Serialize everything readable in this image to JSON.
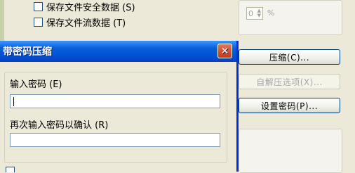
{
  "options": {
    "save_security_label": "保存文件安全数据 (S)",
    "save_streams_label": "保存文件流数据 (T)"
  },
  "right_panel": {
    "spinner_value": "0",
    "percent_sign": "%",
    "compress_button": "压缩(C)...",
    "extract_options_button": "自解压选项(X)...",
    "set_password_button": "设置密码(P)..."
  },
  "dialog": {
    "title": "带密码压缩",
    "close_glyph": "✕",
    "enter_password_label": "输入密码 (E)",
    "enter_password_value": "",
    "reenter_password_label": "再次输入密码以确认 (R)",
    "reenter_password_value": ""
  }
}
